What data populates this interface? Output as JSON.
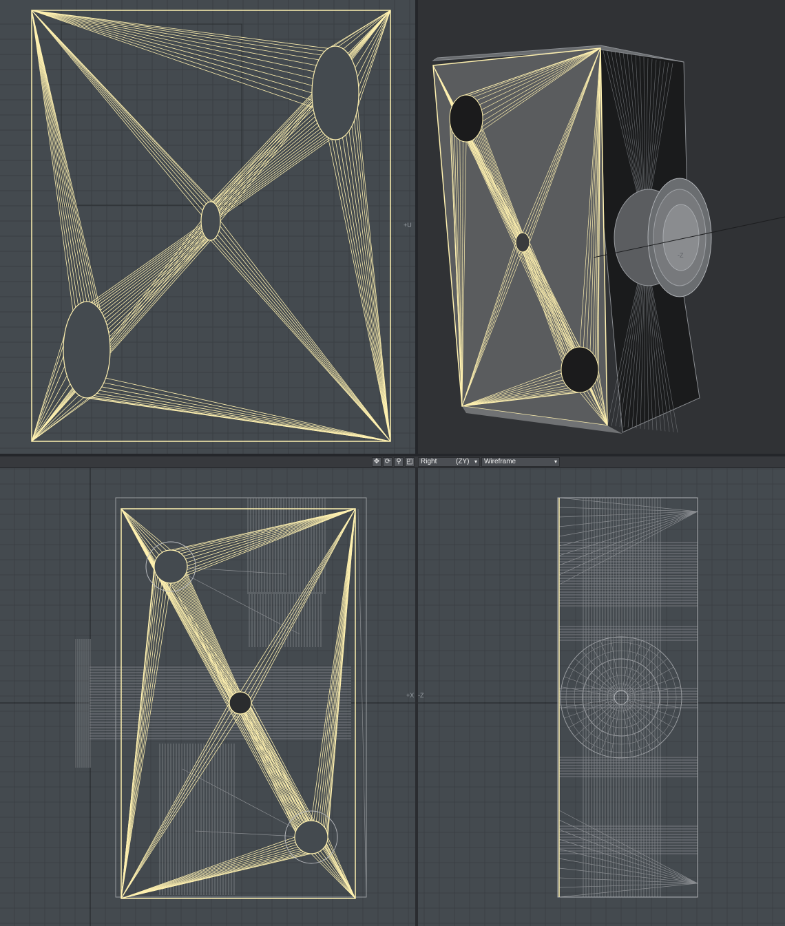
{
  "viewports": {
    "uv": {
      "axis_label": "+U"
    },
    "perspective": {
      "axis_label": "-Z"
    },
    "right": {
      "axis_label": "+X"
    },
    "back": {
      "axis_label": "-Z"
    }
  },
  "toolbar": {
    "view_label": "Right",
    "axes_label": "(ZY)",
    "render_mode": "Wireframe"
  },
  "colors": {
    "selection": "#fff1b0",
    "wire": "#8a8d91",
    "grid": "#55595d",
    "viewport_bg": "#444a4f"
  },
  "icons": [
    "move-icon",
    "rotate-icon",
    "zoom-icon",
    "maximize-icon"
  ]
}
